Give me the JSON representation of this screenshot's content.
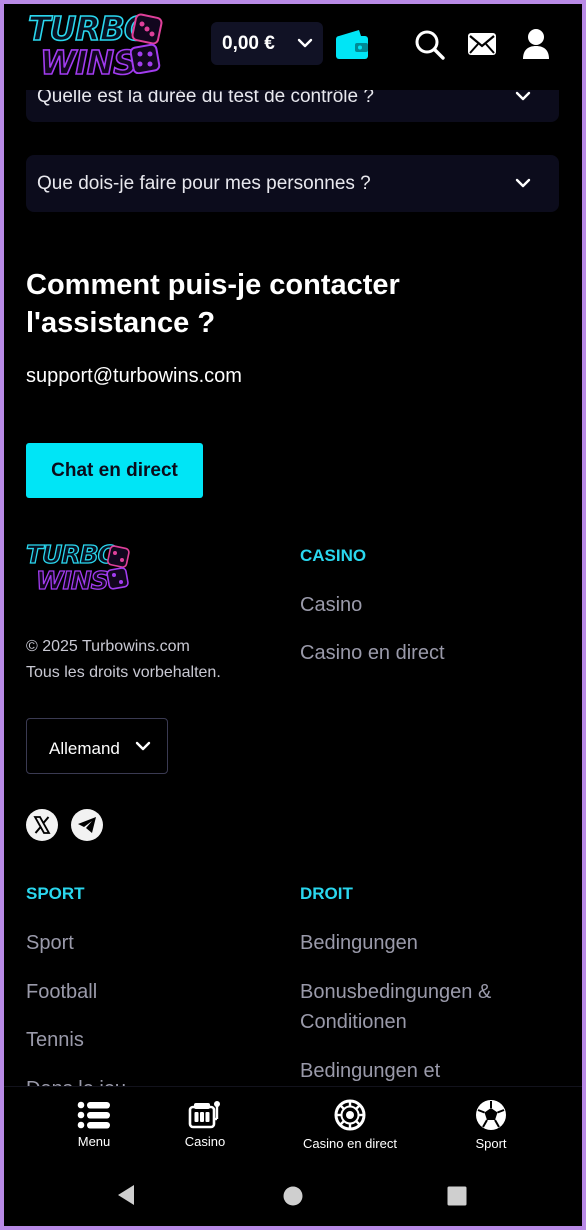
{
  "header": {
    "logo_line1": "TURBO",
    "logo_line2": "WINS",
    "balance": "0,00 €"
  },
  "faq": [
    {
      "question": "Quelle est la durée du test de contrôle ?"
    },
    {
      "question": "Que dois-je faire pour mes personnes ?"
    }
  ],
  "contact": {
    "title_line1": "Comment puis-je contacter",
    "title_line2": "l'assistance ?",
    "email": "support@turbowins.com",
    "chat_button": "Chat en direct"
  },
  "footer": {
    "logo_line1": "TURBO",
    "logo_line2": "WINS",
    "copyright": "© 2025 Turbowins.com",
    "rights": "Tous les droits vorbehalten.",
    "language": "Allemand",
    "casino_heading": "CASINO",
    "casino_links": [
      "Casino",
      "Casino en direct"
    ],
    "sport_heading": "SPORT",
    "sport_links": [
      "Sport",
      "Football",
      "Tennis",
      "Dans le jeu"
    ],
    "droit_heading": "DROIT",
    "droit_links": [
      "Bedingungen",
      "Bonusbedingungen &",
      "Conditionen",
      "Bedingungen et"
    ]
  },
  "bottom_nav": [
    {
      "label": "Menu",
      "icon": "menu-icon"
    },
    {
      "label": "Casino",
      "icon": "slot-machine-icon"
    },
    {
      "label": "Casino en direct",
      "icon": "roulette-chip-icon"
    },
    {
      "label": "Sport",
      "icon": "soccer-ball-icon"
    }
  ],
  "colors": {
    "accent": "#00e5f6",
    "section_heading": "#2ad7ee",
    "background": "#000000",
    "card": "#0c0c1c",
    "logo_cyan": "#2ad7ee",
    "logo_purple": "#a23cf0"
  }
}
